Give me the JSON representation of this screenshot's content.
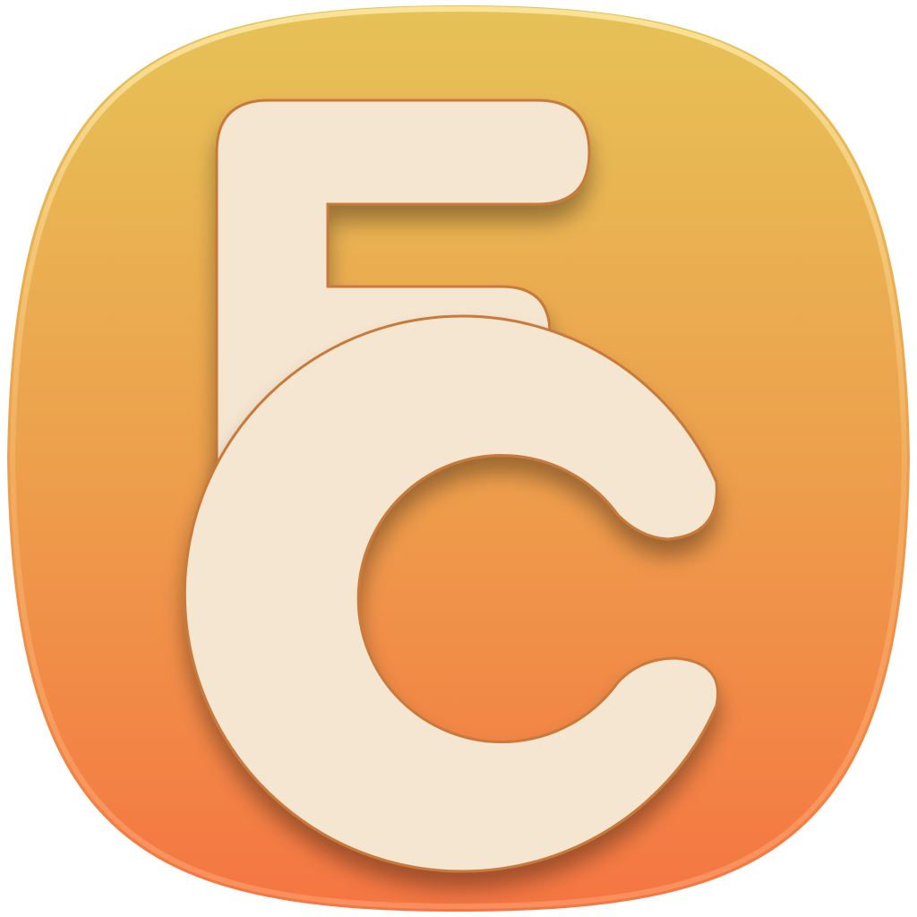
{
  "icon": {
    "monogram": "FC",
    "colors": {
      "gradient_top": "#E6C257",
      "gradient_mid": "#EDA04C",
      "gradient_bottom": "#F57542",
      "letter_fill": "#F5E6D1",
      "letter_edge": "#C97A3A",
      "edge_highlight": "#F8D985"
    }
  }
}
